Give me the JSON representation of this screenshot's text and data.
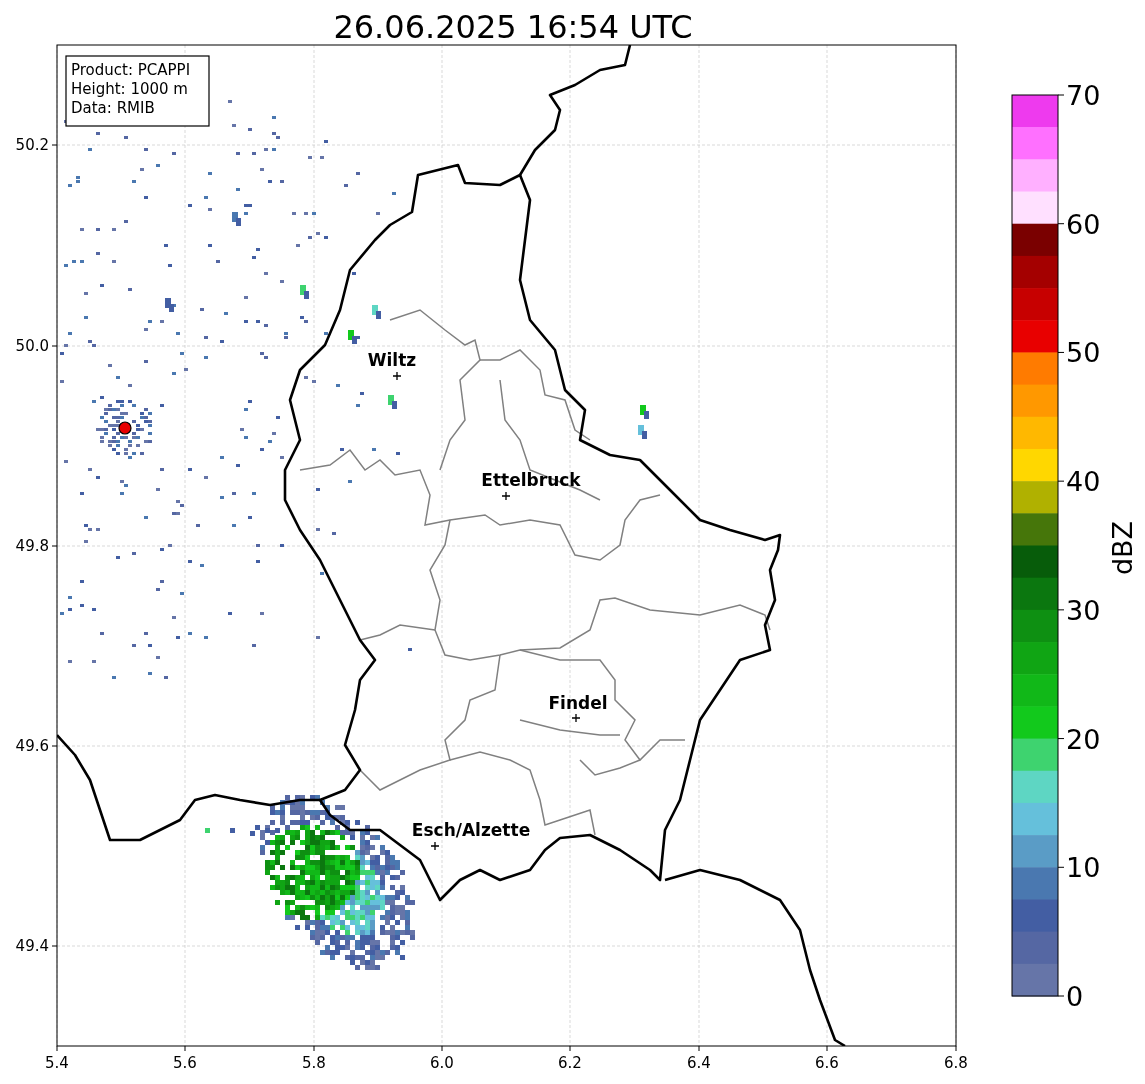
{
  "title": "26.06.2025 16:54 UTC",
  "info_box": [
    "Product: PCAPPI",
    "Height: 1000 m",
    "Data: RMIB"
  ],
  "map": {
    "y_ticks": [
      "50.2",
      "50.0",
      "49.8",
      "49.6",
      "49.4"
    ],
    "x_ticks": [
      "5.4",
      "5.6",
      "5.8",
      "6.0",
      "6.2",
      "6.4",
      "6.6",
      "6.8"
    ],
    "places": [
      {
        "label": "Wiltz"
      },
      {
        "label": "Ettelbruck"
      },
      {
        "label": "Findel"
      },
      {
        "label": "Esch/Alzette"
      }
    ]
  },
  "colorbar": {
    "label": "dBZ",
    "ticks": [
      "70",
      "60",
      "50",
      "40",
      "30",
      "20",
      "10",
      "0"
    ],
    "bins": [
      {
        "color": "#ee3aee"
      },
      {
        "color": "#ff70ff"
      },
      {
        "color": "#ffb0ff"
      },
      {
        "color": "#ffe0ff"
      },
      {
        "color": "#7a0000"
      },
      {
        "color": "#a40000"
      },
      {
        "color": "#c70000"
      },
      {
        "color": "#e80000"
      },
      {
        "color": "#ff7b00"
      },
      {
        "color": "#ff9800"
      },
      {
        "color": "#ffb800"
      },
      {
        "color": "#ffd700"
      },
      {
        "color": "#b0b100"
      },
      {
        "color": "#46760a"
      },
      {
        "color": "#075c0a"
      },
      {
        "color": "#0b770f"
      },
      {
        "color": "#0e9012"
      },
      {
        "color": "#10a514"
      },
      {
        "color": "#11b818"
      },
      {
        "color": "#12c91c"
      },
      {
        "color": "#3ed36f"
      },
      {
        "color": "#5ed6c3"
      },
      {
        "color": "#65c0db"
      },
      {
        "color": "#5a9cc6"
      },
      {
        "color": "#4a78b0"
      },
      {
        "color": "#435ea3"
      },
      {
        "color": "#5567a3"
      },
      {
        "color": "#6675a8"
      }
    ]
  }
}
